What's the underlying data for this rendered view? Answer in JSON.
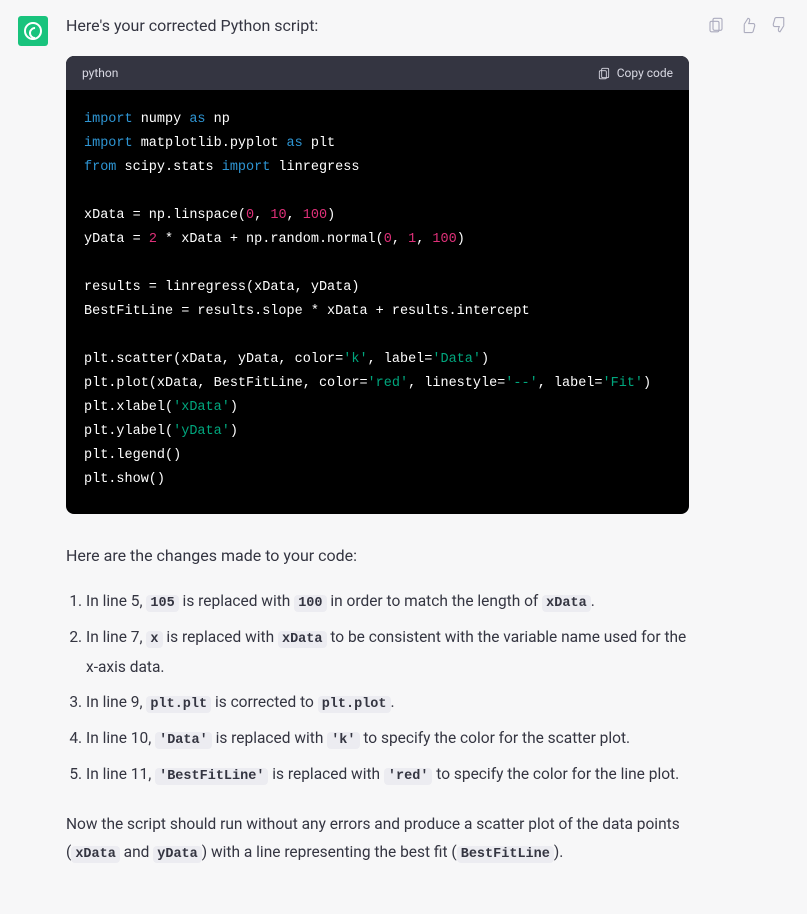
{
  "intro": "Here's your corrected Python script:",
  "code": {
    "language": "python",
    "copy_label": "Copy code",
    "tokens": [
      [
        "k-import",
        "import"
      ],
      [
        "",
        " numpy "
      ],
      [
        "k-as",
        "as"
      ],
      [
        "",
        " np\n"
      ],
      [
        "k-import",
        "import"
      ],
      [
        "",
        " matplotlib.pyplot "
      ],
      [
        "k-as",
        "as"
      ],
      [
        "",
        " plt\n"
      ],
      [
        "k-from",
        "from"
      ],
      [
        "",
        " scipy.stats "
      ],
      [
        "k-import",
        "import"
      ],
      [
        "",
        " linregress\n"
      ],
      [
        "",
        "\n"
      ],
      [
        "",
        "xData = np.linspace("
      ],
      [
        "num",
        "0"
      ],
      [
        "",
        ", "
      ],
      [
        "num",
        "10"
      ],
      [
        "",
        ", "
      ],
      [
        "num",
        "100"
      ],
      [
        "",
        ")\n"
      ],
      [
        "",
        "yData = "
      ],
      [
        "num",
        "2"
      ],
      [
        "",
        " * xData + np.random.normal("
      ],
      [
        "num",
        "0"
      ],
      [
        "",
        ", "
      ],
      [
        "num",
        "1"
      ],
      [
        "",
        ", "
      ],
      [
        "num",
        "100"
      ],
      [
        "",
        ")\n"
      ],
      [
        "",
        "\n"
      ],
      [
        "",
        "results = linregress(xData, yData)\n"
      ],
      [
        "",
        "BestFitLine = results.slope * xData + results.intercept\n"
      ],
      [
        "",
        "\n"
      ],
      [
        "",
        "plt.scatter(xData, yData, color="
      ],
      [
        "str",
        "'k'"
      ],
      [
        "",
        ", label="
      ],
      [
        "str",
        "'Data'"
      ],
      [
        "",
        ")\n"
      ],
      [
        "",
        "plt.plot(xData, BestFitLine, color="
      ],
      [
        "str",
        "'red'"
      ],
      [
        "",
        ", linestyle="
      ],
      [
        "str",
        "'--'"
      ],
      [
        "",
        ", label="
      ],
      [
        "str",
        "'Fit'"
      ],
      [
        "",
        ")\n"
      ],
      [
        "",
        "plt.xlabel("
      ],
      [
        "str",
        "'xData'"
      ],
      [
        "",
        ")\n"
      ],
      [
        "",
        "plt.ylabel("
      ],
      [
        "str",
        "'yData'"
      ],
      [
        "",
        ")\n"
      ],
      [
        "",
        "plt.legend()\n"
      ],
      [
        "",
        "plt.show()\n"
      ]
    ]
  },
  "changes_intro": "Here are the changes made to your code:",
  "changes": [
    [
      [
        "t",
        "In line 5, "
      ],
      [
        "c",
        "`105`"
      ],
      [
        "t",
        " is replaced with "
      ],
      [
        "c",
        "`100`"
      ],
      [
        "t",
        " in order to match the length of "
      ],
      [
        "c",
        "`xData`"
      ],
      [
        "t",
        "."
      ]
    ],
    [
      [
        "t",
        "In line 7, "
      ],
      [
        "c",
        "`x`"
      ],
      [
        "t",
        " is replaced with "
      ],
      [
        "c",
        "`xData`"
      ],
      [
        "t",
        " to be consistent with the variable name used for the x-axis data."
      ]
    ],
    [
      [
        "t",
        "In line 9, "
      ],
      [
        "c",
        "`plt.plt`"
      ],
      [
        "t",
        " is corrected to "
      ],
      [
        "c",
        "`plt.plot`"
      ],
      [
        "t",
        "."
      ]
    ],
    [
      [
        "t",
        "In line 10, "
      ],
      [
        "c",
        "`'Data'`"
      ],
      [
        "t",
        " is replaced with "
      ],
      [
        "c",
        "`'k'`"
      ],
      [
        "t",
        " to specify the color for the scatter plot."
      ]
    ],
    [
      [
        "t",
        "In line 11, "
      ],
      [
        "c",
        "`'BestFitLine'`"
      ],
      [
        "t",
        " is replaced with "
      ],
      [
        "c",
        "`'red'`"
      ],
      [
        "t",
        " to specify the color for the line plot."
      ]
    ]
  ],
  "closing": [
    [
      "t",
      "Now the script should run without any errors and produce a scatter plot of the data points ("
    ],
    [
      "c",
      "`xData`"
    ],
    [
      "t",
      " and "
    ],
    [
      "c",
      "`yData`"
    ],
    [
      "t",
      ") with a line representing the best fit ("
    ],
    [
      "c",
      "`BestFitLine`"
    ],
    [
      "t",
      ")."
    ]
  ]
}
